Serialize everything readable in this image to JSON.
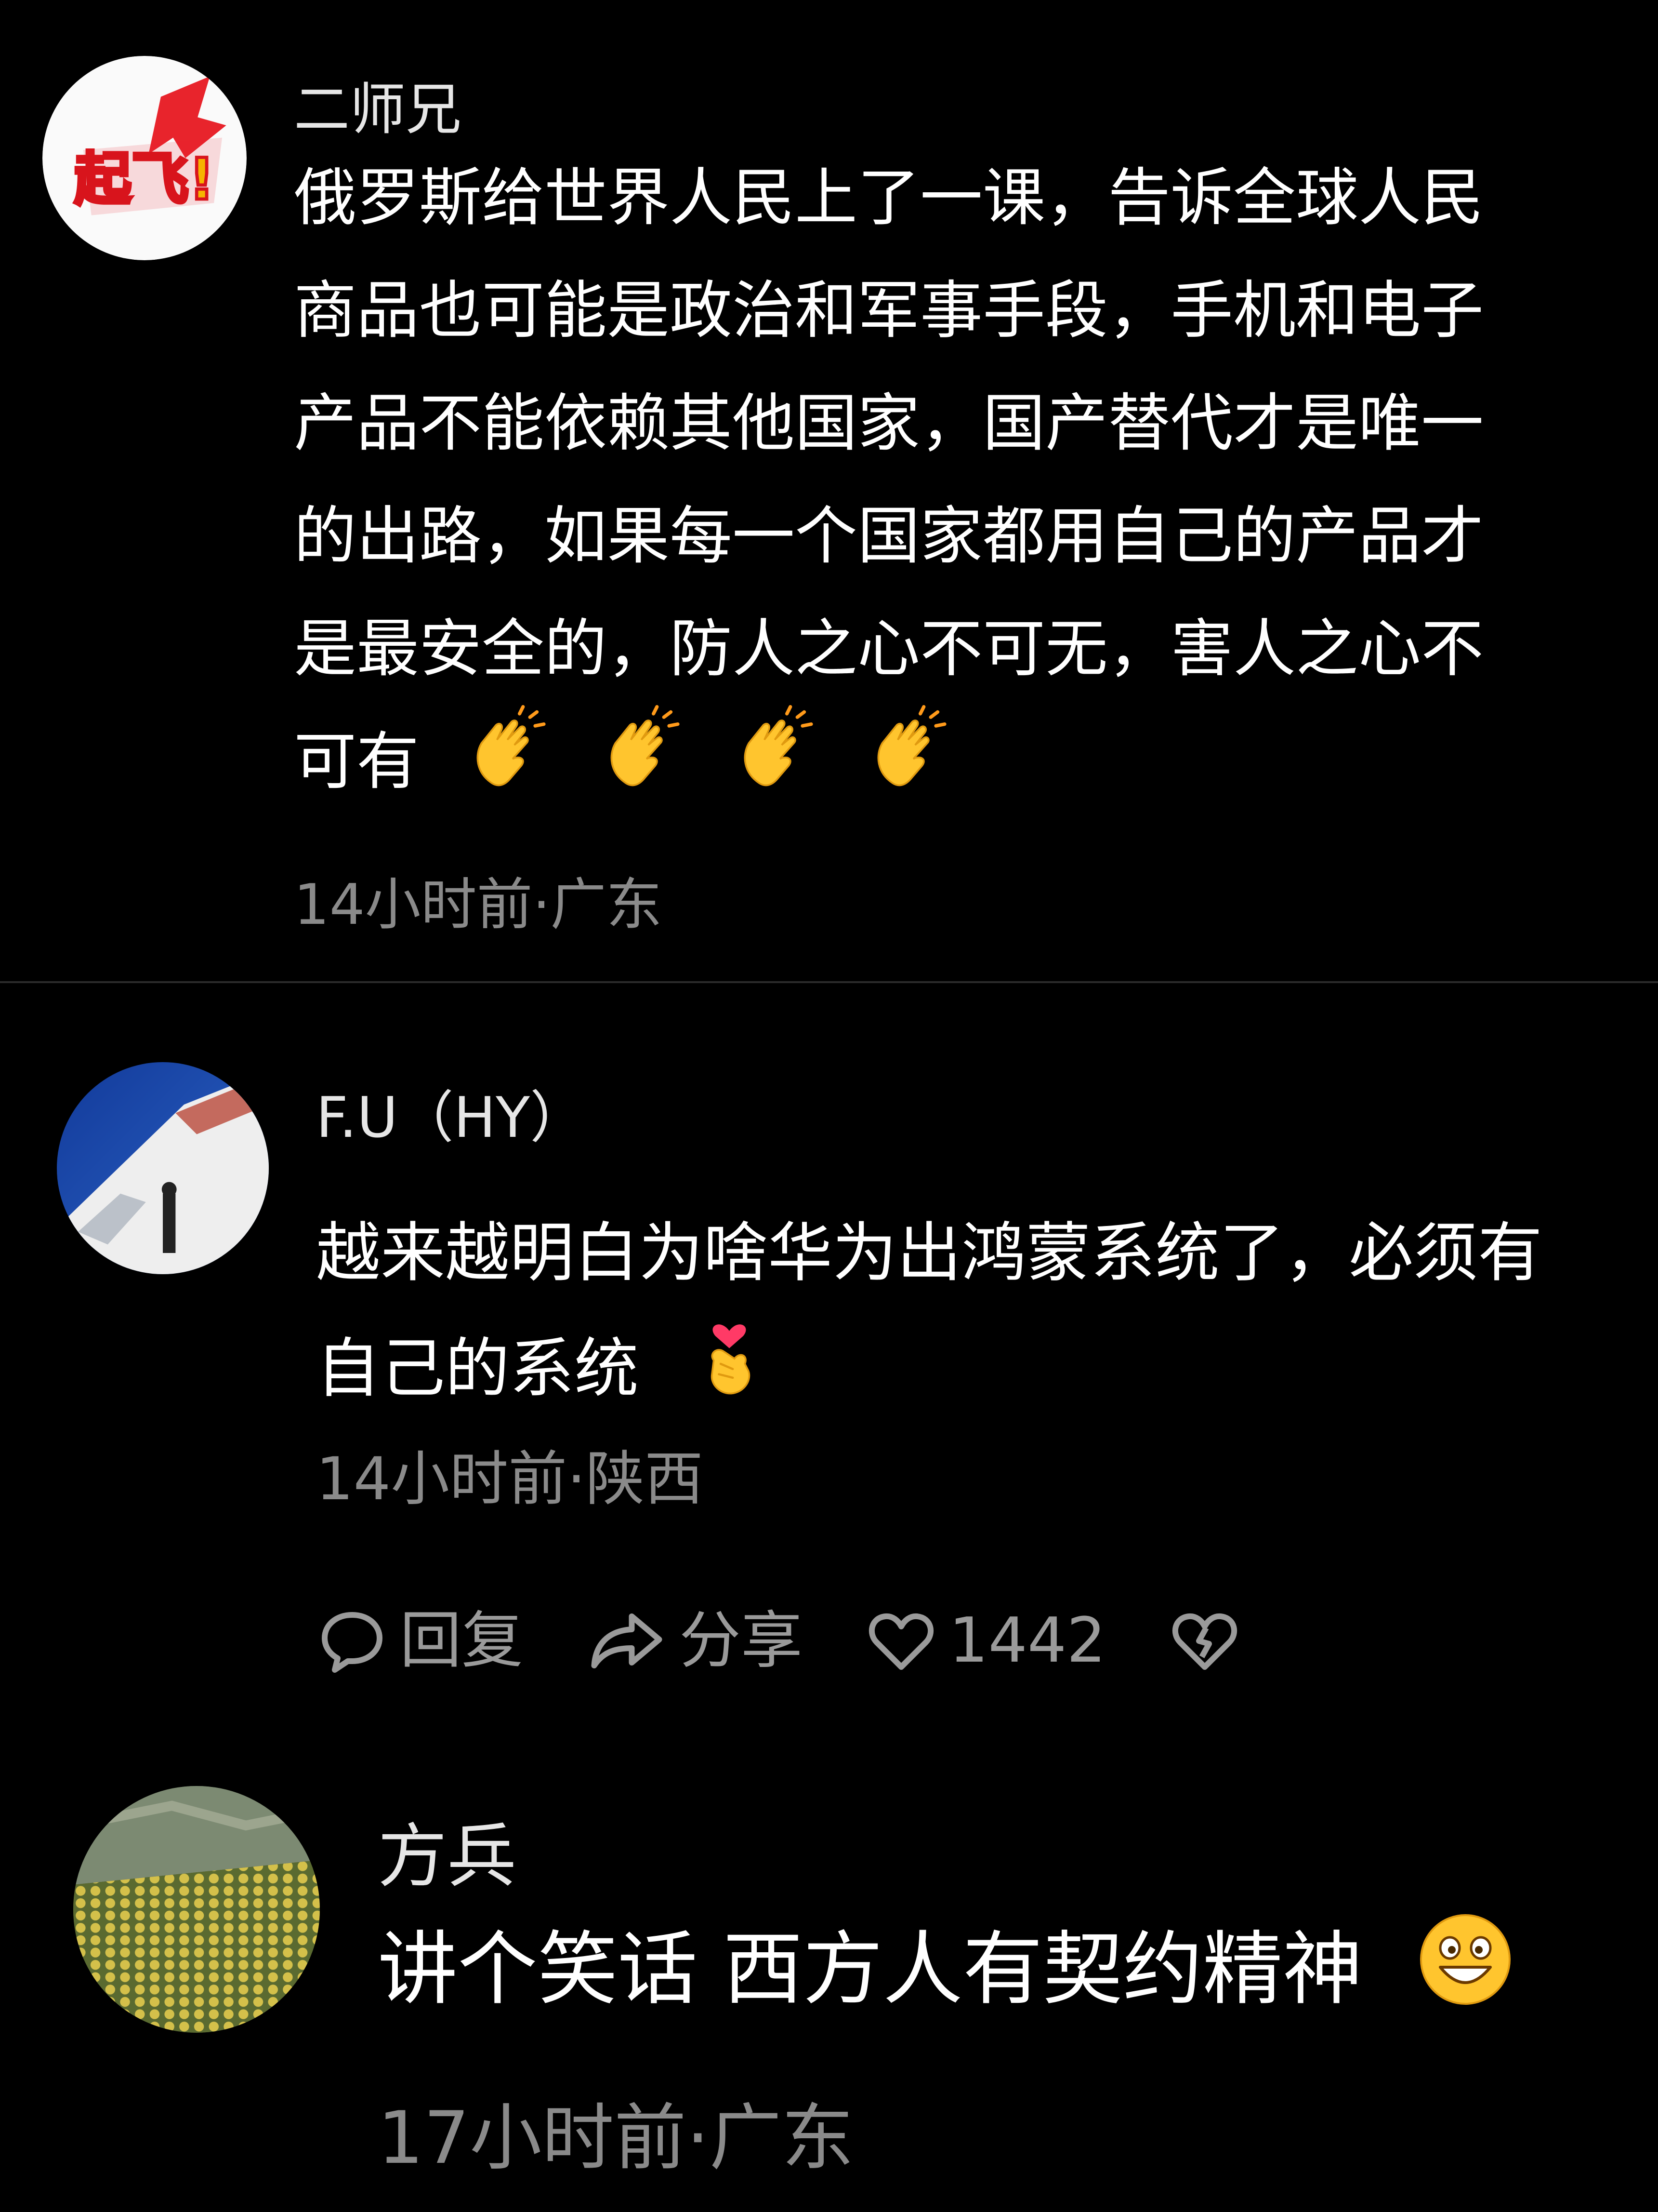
{
  "comments": [
    {
      "username": "二师兄",
      "avatar_text": "起飞!",
      "body_lines": [
        "俄罗斯给世界人民上了一课，告诉全球人民",
        "商品也可能是政治和军事手段，手机和电子",
        "产品不能依赖其他国家，国产替代才是唯一",
        "的出路，如果每一个国家都用自己的产品才",
        "是最安全的，防人之心不可无，害人之心不",
        "可有"
      ],
      "emojis": [
        "clapping-hands",
        "clapping-hands",
        "clapping-hands",
        "clapping-hands"
      ],
      "meta": "14小时前·广东"
    },
    {
      "username": "F.U（HY）",
      "body_lines": [
        "越来越明白为啥华为出鸿蒙系统了，必须有",
        "自己的系统"
      ],
      "emojis": [
        "heart-fingers"
      ],
      "meta": "14小时前·陕西"
    },
    {
      "username": "方兵",
      "body_lines": [
        "讲个笑话 西方人有契约精神"
      ],
      "emojis": [
        "grinning-face"
      ],
      "meta": "17小时前·广东"
    }
  ],
  "actions": {
    "reply_label": "回复",
    "share_label": "分享",
    "like_count": "1442"
  },
  "colors": {
    "background": "#000000",
    "text": "#ffffff",
    "meta": "#8a8a8a",
    "divider": "#2b2b2b",
    "emoji_yellow": "#ffc52e"
  }
}
